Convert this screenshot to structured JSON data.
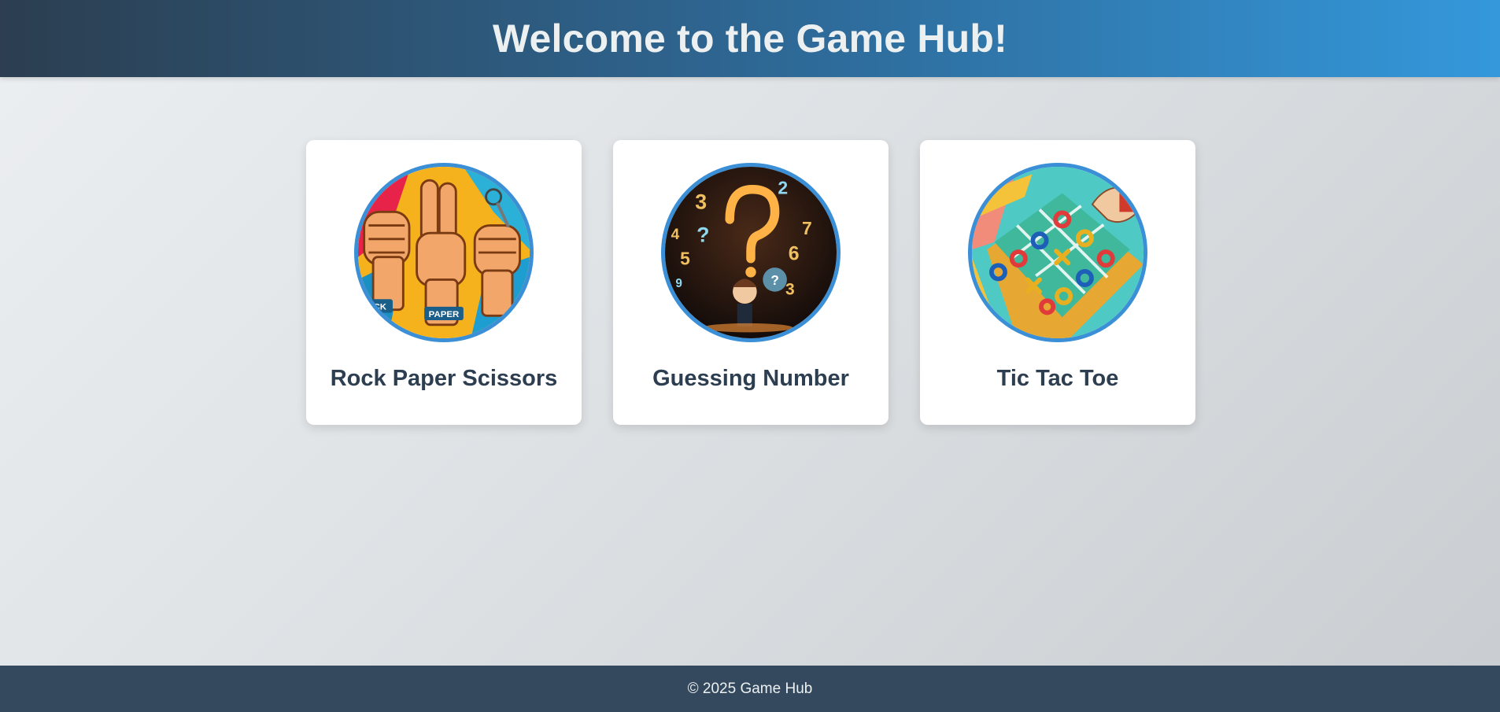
{
  "header": {
    "title": "Welcome to the Game Hub!"
  },
  "games": [
    {
      "title": "Rock Paper Scissors",
      "image_icon": "rock-paper-scissors-hands-icon",
      "image_text": [
        "CK",
        "PAPER"
      ]
    },
    {
      "title": "Guessing Number",
      "image_icon": "question-mark-numbers-icon",
      "image_text": [
        "3",
        "2",
        "?",
        "7",
        "5",
        "6",
        "4",
        "9",
        "3"
      ]
    },
    {
      "title": "Tic Tac Toe",
      "image_icon": "tic-tac-toe-board-icon"
    }
  ],
  "footer": {
    "text": "© 2025 Game Hub"
  },
  "colors": {
    "header_start": "#2c3e50",
    "header_end": "#3498db",
    "footer_bg": "#34495e",
    "title_text": "#2c3e50",
    "image_border": "#3a8fd6"
  }
}
